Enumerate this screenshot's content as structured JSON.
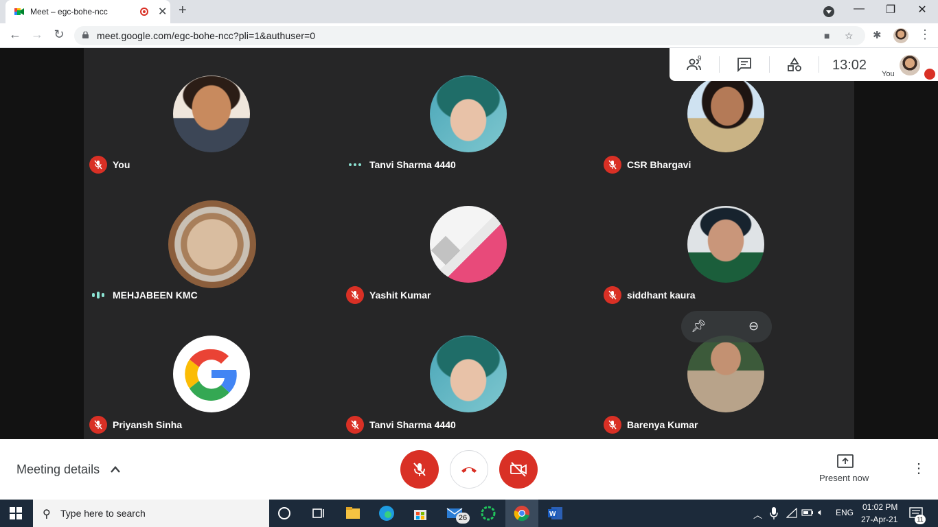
{
  "browser": {
    "tab_title": "Meet – egc-bohe-ncc",
    "new_tab_glyph": "+",
    "close_glyph": "✕",
    "url": "meet.google.com/egc-bohe-ncc?pli=1&authuser=0",
    "window_controls": {
      "minimize": "—",
      "restore": "❐",
      "close": "✕"
    }
  },
  "meet": {
    "panel": {
      "participant_count": "9",
      "time": "13:02",
      "you_label": "You"
    },
    "participants": [
      {
        "name": "You",
        "status": "muted",
        "avatar": "photo-man"
      },
      {
        "name": "Tanvi Sharma 4440",
        "status": "speaking-idle",
        "avatar": "photo-tanvi"
      },
      {
        "name": "CSR Bhargavi",
        "status": "muted",
        "avatar": "photo-woman"
      },
      {
        "name": "MEHJABEEN KMC",
        "status": "speaking",
        "avatar": "photo-tea"
      },
      {
        "name": "Yashit Kumar",
        "status": "muted",
        "avatar": "pattern-pink"
      },
      {
        "name": "siddhant kaura",
        "status": "muted",
        "avatar": "photo-boy"
      },
      {
        "name": "Priyansh Sinha",
        "status": "muted",
        "avatar": "google-logo"
      },
      {
        "name": "Tanvi Sharma 4440",
        "status": "muted",
        "avatar": "photo-tanvi"
      },
      {
        "name": "Barenya Kumar",
        "status": "muted",
        "avatar": "photo-barenya"
      }
    ],
    "controls": {
      "meeting_details": "Meeting details",
      "present_now": "Present now"
    }
  },
  "taskbar": {
    "search_placeholder": "Type here to search",
    "mail_badge": "26",
    "language": "ENG",
    "time": "01:02 PM",
    "date": "27-Apr-21",
    "notification_count": "11"
  },
  "colors": {
    "meet_red": "#d93025",
    "stage_bg": "#202124",
    "speaking": "#8ce3d3",
    "taskbar": "#1c2a3a"
  }
}
